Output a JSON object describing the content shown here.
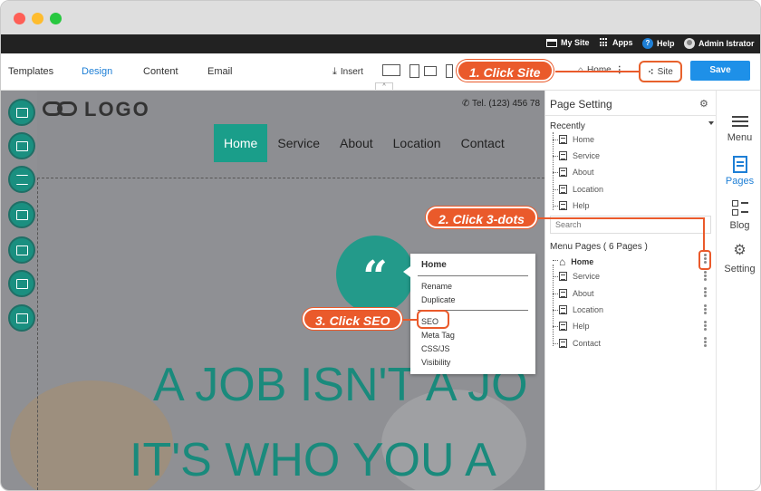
{
  "topbar": {
    "my_site": "My Site",
    "apps": "Apps",
    "help": "Help",
    "user": "Admin Istrator"
  },
  "toolbar": {
    "tabs": [
      "Templates",
      "Design",
      "Content",
      "Email"
    ],
    "active_tab": "Design",
    "insert": "Insert",
    "page_select": "Home",
    "site": "Site",
    "save": "Save"
  },
  "callouts": {
    "step1": "1. Click Site",
    "step2": "2. Click 3-dots",
    "step3": "3. Click SEO"
  },
  "site_preview": {
    "logo": "LOGO",
    "tel": "Tel. (123) 456 78",
    "nav": [
      "Home",
      "Service",
      "About",
      "Location",
      "Contact"
    ],
    "quote_mark": "“",
    "headline_1": "A JOB ISN'T A JO",
    "headline_2": "IT'S WHO YOU A"
  },
  "context_menu": {
    "title": "Home",
    "items": [
      "Rename",
      "Duplicate",
      "SEO",
      "Meta Tag",
      "CSS/JS",
      "Visibility"
    ]
  },
  "page_setting": {
    "title": "Page Setting",
    "recently_label": "Recently",
    "recently": [
      "Home",
      "Service",
      "About",
      "Location",
      "Help"
    ],
    "search_placeholder": "Search",
    "menu_pages_label": "Menu Pages ( 6 Pages )",
    "menu_pages": [
      "Home",
      "Service",
      "About",
      "Location",
      "Help",
      "Contact"
    ]
  },
  "right_sidebar": [
    "Menu",
    "Pages",
    "Blog",
    "Setting"
  ],
  "colors": {
    "accent": "#1e90e8",
    "brand_teal": "#1a9e8a",
    "callout": "#ea5a2b"
  }
}
